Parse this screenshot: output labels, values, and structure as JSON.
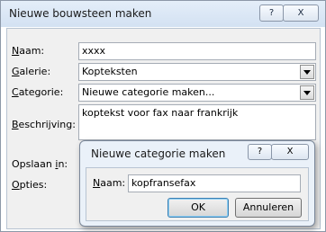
{
  "main_dialog": {
    "title": "Nieuwe bouwsteen maken",
    "help_glyph": "?",
    "close_glyph": "X",
    "fields": {
      "naam": {
        "label_prefix": "",
        "label_key": "N",
        "label_rest": "aam:",
        "value": "xxxx"
      },
      "galerie": {
        "label_prefix": "",
        "label_key": "G",
        "label_rest": "alerie:",
        "value": "Kopteksten"
      },
      "categorie": {
        "label_prefix": "",
        "label_key": "C",
        "label_rest": "ategorie:",
        "value": "Nieuwe categorie maken..."
      },
      "beschrijving": {
        "label_prefix": "",
        "label_key": "B",
        "label_rest": "eschrijving:",
        "value": "koptekst voor fax naar frankrijk"
      },
      "opslaan_in": {
        "label_prefix": "Opslaan ",
        "label_key": "i",
        "label_rest": "n:"
      },
      "opties": {
        "label_prefix": "",
        "label_key": "O",
        "label_rest": "pties:"
      }
    }
  },
  "modal": {
    "title": "Nieuwe categorie maken",
    "help_glyph": "?",
    "close_glyph": "X",
    "naam_label_key": "N",
    "naam_label_rest": "aam:",
    "naam_value": "kopfransefax",
    "ok_label": "OK",
    "cancel_label": "Annuleren"
  }
}
